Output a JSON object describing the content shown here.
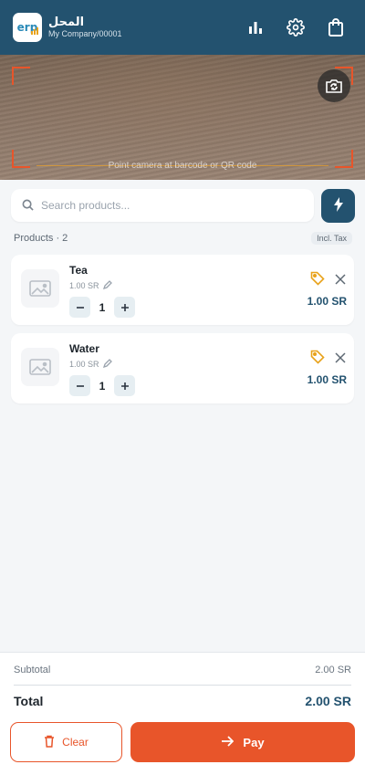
{
  "header": {
    "logo_text": "erp",
    "store_name": "المحل",
    "company": "My Company/00001",
    "icons": [
      "bar-chart-icon",
      "gear-icon",
      "shopping-bag-icon"
    ]
  },
  "camera": {
    "hint": "Point camera at barcode or QR code",
    "switch_icon": "camera-switch-icon"
  },
  "search": {
    "placeholder": "Search products..."
  },
  "products": {
    "label": "Products · 2",
    "tax_label": "Incl. Tax",
    "items": [
      {
        "name": "Tea",
        "unit_price": "1.00 SR",
        "qty": "1",
        "total": "1.00 SR"
      },
      {
        "name": "Water",
        "unit_price": "1.00 SR",
        "qty": "1",
        "total": "1.00 SR"
      }
    ]
  },
  "summary": {
    "subtotal_label": "Subtotal",
    "subtotal_value": "2.00 SR",
    "total_label": "Total",
    "total_value": "2.00 SR"
  },
  "actions": {
    "clear_label": "Clear",
    "pay_label": "Pay"
  },
  "colors": {
    "primary": "#23526f",
    "accent": "#e8552a",
    "tag": "#e8a21a"
  }
}
